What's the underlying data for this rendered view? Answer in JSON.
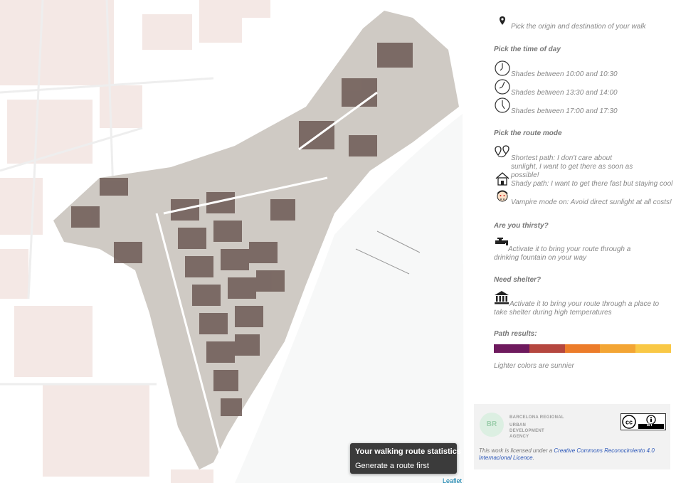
{
  "map": {
    "stats_title": "Your walking route statistics",
    "stats_subtitle": "Generate a route first",
    "attribution": "Leaflet"
  },
  "panel": {
    "origin_text": "Pick the origin and destination of your walk",
    "time_heading": "Pick the time of day",
    "time_options": [
      "Shades between 10:00 and 10:30",
      "Shades between 13:30 and 14:00",
      "Shades between 17:00 and 17:30"
    ],
    "route_heading": "Pick the route mode",
    "route_modes": [
      "Shortest path: I don't care about sunlight, I want to get there as soon as possible!",
      "Shady path: I want to get there fast but staying cool",
      "Vampire mode on: Avoid direct sunlight at all costs!"
    ],
    "thirsty_heading": "Are you thirsty?",
    "thirsty_text": "Activate it to bring your route through a drinking fountain on your way",
    "shelter_heading": "Need shelter?",
    "shelter_text": "Activate it to bring your route through a place to take shelter during high temperatures",
    "results_heading": "Path results:",
    "scale_colors": [
      "#6e1a5e",
      "#b5473f",
      "#ec7c2a",
      "#f3a534",
      "#f9c846"
    ],
    "scale_caption": "Lighter colors are sunnier"
  },
  "footer": {
    "logo_text": "BR",
    "agency_lines": [
      "BARCELONA REGIONAL",
      "URBAN",
      "DEVELOPMENT",
      "AGENCY"
    ],
    "cc_badge": "BY",
    "license_prefix": "This work is licensed under a ",
    "license_link": "Creative Commons Reconocimiento 4.0 Internacional Licence",
    "license_suffix": "."
  }
}
